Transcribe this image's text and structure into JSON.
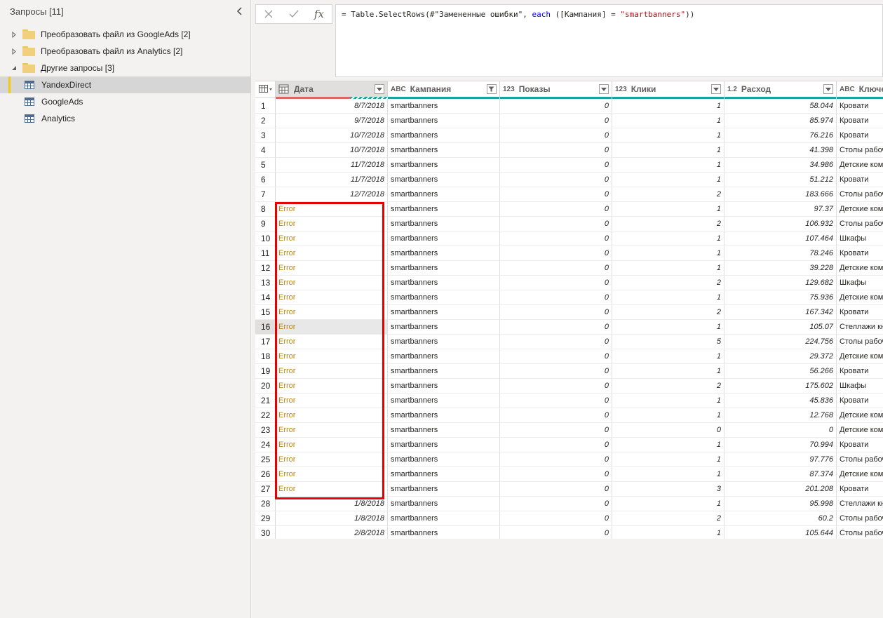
{
  "queries_pane": {
    "title": "Запросы [11]",
    "groups": [
      {
        "label": "Преобразовать файл из GoogleAds [2]",
        "expanded": false
      },
      {
        "label": "Преобразовать файл из Analytics [2]",
        "expanded": false
      },
      {
        "label": "Другие запросы [3]",
        "expanded": true
      }
    ],
    "queries": [
      {
        "label": "YandexDirect",
        "selected": true
      },
      {
        "label": "GoogleAds",
        "selected": false
      },
      {
        "label": "Analytics",
        "selected": false
      }
    ]
  },
  "formula_bar": {
    "cancel_icon": "close-icon",
    "confirm_icon": "check-icon",
    "fx_label": "fx",
    "formula_prefix": "= Table.SelectRows(#\"Замененные ошибки\", ",
    "formula_keyword": "each",
    "formula_mid": " ([Кампания] = ",
    "formula_string": "\"smartbanners\"",
    "formula_suffix": "))"
  },
  "grid": {
    "columns": [
      {
        "type": "date",
        "type_label": "",
        "name": "Дата"
      },
      {
        "type": "text",
        "type_label": "ABC",
        "name": "Кампания"
      },
      {
        "type": "int",
        "type_label": "123",
        "name": "Показы"
      },
      {
        "type": "int",
        "type_label": "123",
        "name": "Клики"
      },
      {
        "type": "decimal",
        "type_label": "1.2",
        "name": "Расход"
      },
      {
        "type": "text",
        "type_label": "ABC",
        "name": "Ключевы"
      }
    ],
    "rows": [
      [
        "8/7/2018",
        "smartbanners",
        "0",
        "1",
        "58.044",
        "Кровати"
      ],
      [
        "9/7/2018",
        "smartbanners",
        "0",
        "1",
        "85.974",
        "Кровати"
      ],
      [
        "10/7/2018",
        "smartbanners",
        "0",
        "1",
        "76.216",
        "Кровати"
      ],
      [
        "10/7/2018",
        "smartbanners",
        "0",
        "1",
        "41.398",
        "Столы рабоч"
      ],
      [
        "11/7/2018",
        "smartbanners",
        "0",
        "1",
        "34.986",
        "Детские ком"
      ],
      [
        "11/7/2018",
        "smartbanners",
        "0",
        "1",
        "51.212",
        "Кровати"
      ],
      [
        "12/7/2018",
        "smartbanners",
        "0",
        "2",
        "183.666",
        "Столы рабоч"
      ],
      [
        "Error",
        "smartbanners",
        "0",
        "1",
        "97.37",
        "Детские ком"
      ],
      [
        "Error",
        "smartbanners",
        "0",
        "2",
        "106.932",
        "Столы рабоч"
      ],
      [
        "Error",
        "smartbanners",
        "0",
        "1",
        "107.464",
        "Шкафы"
      ],
      [
        "Error",
        "smartbanners",
        "0",
        "1",
        "78.246",
        "Кровати"
      ],
      [
        "Error",
        "smartbanners",
        "0",
        "1",
        "39.228",
        "Детские ком"
      ],
      [
        "Error",
        "smartbanners",
        "0",
        "2",
        "129.682",
        "Шкафы"
      ],
      [
        "Error",
        "smartbanners",
        "0",
        "1",
        "75.936",
        "Детские ком"
      ],
      [
        "Error",
        "smartbanners",
        "0",
        "2",
        "167.342",
        "Кровати"
      ],
      [
        "Error",
        "smartbanners",
        "0",
        "1",
        "105.07",
        "Стеллажи кн"
      ],
      [
        "Error",
        "smartbanners",
        "0",
        "5",
        "224.756",
        "Столы рабоч"
      ],
      [
        "Error",
        "smartbanners",
        "0",
        "1",
        "29.372",
        "Детские ком"
      ],
      [
        "Error",
        "smartbanners",
        "0",
        "1",
        "56.266",
        "Кровати"
      ],
      [
        "Error",
        "smartbanners",
        "0",
        "2",
        "175.602",
        "Шкафы"
      ],
      [
        "Error",
        "smartbanners",
        "0",
        "1",
        "45.836",
        "Кровати"
      ],
      [
        "Error",
        "smartbanners",
        "0",
        "1",
        "12.768",
        "Детские ком"
      ],
      [
        "Error",
        "smartbanners",
        "0",
        "0",
        "0",
        "Детские ком"
      ],
      [
        "Error",
        "smartbanners",
        "0",
        "1",
        "70.994",
        "Кровати"
      ],
      [
        "Error",
        "smartbanners",
        "0",
        "1",
        "97.776",
        "Столы рабоч"
      ],
      [
        "Error",
        "smartbanners",
        "0",
        "1",
        "87.374",
        "Детские ком"
      ],
      [
        "Error",
        "smartbanners",
        "0",
        "3",
        "201.208",
        "Кровати"
      ],
      [
        "1/8/2018",
        "smartbanners",
        "0",
        "1",
        "95.998",
        "Стеллажи кн"
      ],
      [
        "1/8/2018",
        "smartbanners",
        "0",
        "2",
        "60.2",
        "Столы рабоч"
      ],
      [
        "2/8/2018",
        "smartbanners",
        "0",
        "1",
        "105.644",
        "Столы рабоч"
      ]
    ],
    "selected_row": 16,
    "colors": {
      "error_text": "#b8860b",
      "quality_ok": "#1aa39a",
      "quality_error": "#e06666",
      "highlight": "#e60000"
    }
  }
}
